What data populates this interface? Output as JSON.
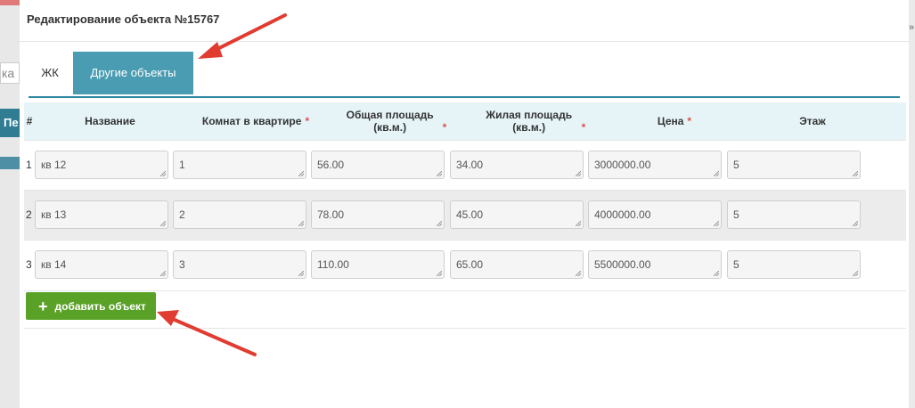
{
  "background": {
    "left_partial_text": "ка",
    "left_button_partial": "Пе",
    "right_partial": "»"
  },
  "modal": {
    "title": "Редактирование объекта №15767"
  },
  "tabs": [
    {
      "label": "ЖК",
      "active": false
    },
    {
      "label": "Другие объекты",
      "active": true
    }
  ],
  "table": {
    "headers": {
      "num": "#",
      "name": "Название",
      "rooms": "Комнат в квартире",
      "total_area": "Общая площадь (кв.м.)",
      "living_area": "Жилая площадь (кв.м.)",
      "price": "Цена",
      "floor": "Этаж"
    },
    "required_mark": "*",
    "rows": [
      {
        "num": "1",
        "name": "кв 12",
        "rooms": "1",
        "total_area": "56.00",
        "living_area": "34.00",
        "price": "3000000.00",
        "floor": "5"
      },
      {
        "num": "2",
        "name": "кв 13",
        "rooms": "2",
        "total_area": "78.00",
        "living_area": "45.00",
        "price": "4000000.00",
        "floor": "5"
      },
      {
        "num": "3",
        "name": "кв 14",
        "rooms": "3",
        "total_area": "110.00",
        "living_area": "65.00",
        "price": "5500000.00",
        "floor": "5"
      }
    ]
  },
  "add_button": {
    "icon": "+",
    "label": "добавить объект"
  },
  "colors": {
    "accent": "#4a9cb2",
    "tab_border": "#2e86a0",
    "add_button": "#5aa127",
    "annotation_arrow": "#e03c31"
  }
}
